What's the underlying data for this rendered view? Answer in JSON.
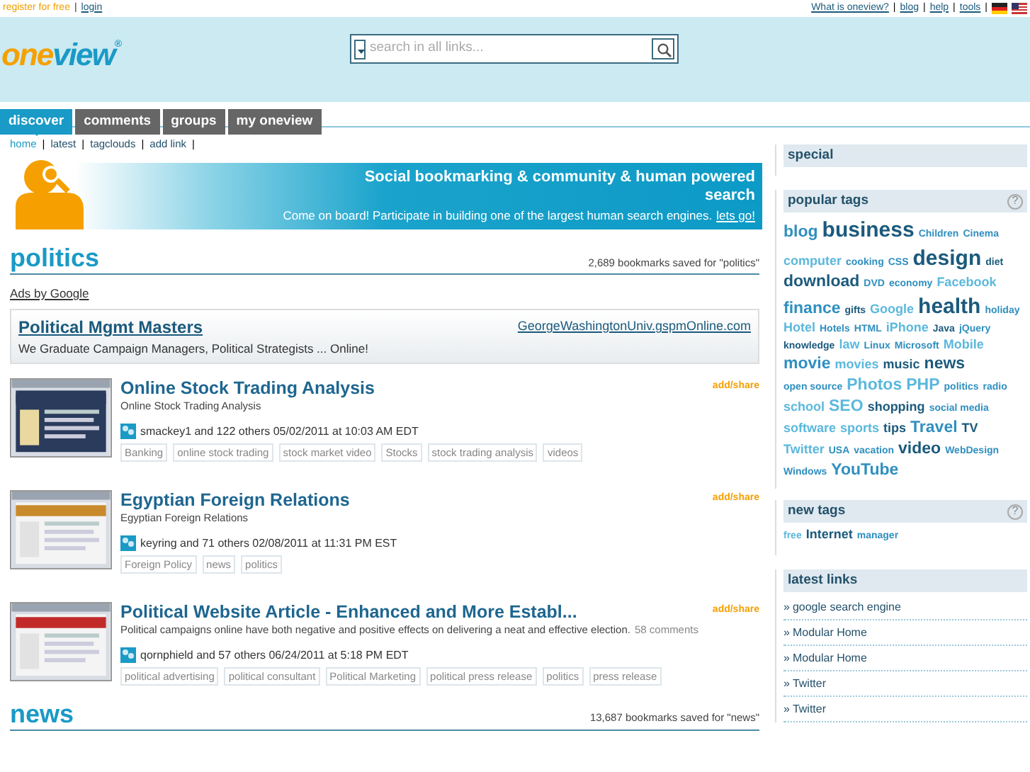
{
  "top_bar": {
    "separator": "|",
    "left_links": [
      "register for free",
      "login"
    ],
    "right_links": [
      "What is oneview?",
      "blog",
      "help",
      "tools"
    ]
  },
  "header": {
    "logo": {
      "part_1": "one",
      "part_2": "view",
      "mark": "®"
    },
    "search": {
      "placeholder": "search in all links..."
    }
  },
  "tabs": [
    {
      "label": "discover",
      "selected": true
    },
    {
      "label": "comments",
      "selected": false
    },
    {
      "label": "groups",
      "selected": false
    },
    {
      "label": "my oneview",
      "selected": false
    }
  ],
  "subnav": {
    "separator": "|",
    "links": [
      {
        "label": "home",
        "selected": true
      },
      {
        "label": "latest",
        "selected": false
      },
      {
        "label": "tagclouds",
        "selected": false
      },
      {
        "label": "add link",
        "selected": false
      }
    ]
  },
  "banner": {
    "headline": "Social bookmarking & community & human powered search",
    "text": "Come on board! Participate in building one of the largest human search engines.",
    "link": "lets go!"
  },
  "sections": [
    {
      "title": "politics",
      "count": "2,689 bookmarks saved for \"politics\"",
      "ads_label": "Ads by Google",
      "ad": {
        "title": "Political Mgmt Masters",
        "url": "GeorgeWashingtonUniv.gspmOnline.com",
        "text": "We Graduate Campaign Managers, Political Strategists ... Online!"
      },
      "items": [
        {
          "title": "Online Stock Trading Analysis",
          "action": "add/share",
          "description": "Online Stock Trading Analysis",
          "meta": "smackey1 and 122 others 05/02/2011 at 10:03 AM EDT",
          "tags": [
            "Banking",
            "online stock trading",
            "stock market video",
            "Stocks",
            "stock trading analysis",
            "videos"
          ]
        },
        {
          "title": "Egyptian Foreign Relations",
          "action": "add/share",
          "description": "Egyptian Foreign Relations",
          "meta": "keyring and 71 others 02/08/2011 at 11:31 PM EST",
          "tags": [
            "Foreign Policy",
            "news",
            "politics"
          ]
        },
        {
          "title": "Political Website Article - Enhanced and More Establ...",
          "action": "add/share",
          "description": "Political campaigns online have both negative and positive effects on delivering a neat and effective election.",
          "comments": "58 comments",
          "meta": "qornphield and 57 others 06/24/2011 at 5:18 PM EDT",
          "tags": [
            "political advertising",
            "political consultant",
            "Political Marketing",
            "political press release",
            "politics",
            "press release"
          ]
        }
      ]
    },
    {
      "title": "news",
      "count": "13,687 bookmarks saved for \"news\""
    }
  ],
  "sidebar": {
    "special": {
      "title": "special"
    },
    "popular_tags": {
      "title": "popular tags",
      "help": "?",
      "tags": [
        {
          "label": "blog",
          "kind": "large",
          "color": "#2f8fbf"
        },
        {
          "label": "business",
          "kind": "huge",
          "color": "#1b5a7c"
        },
        {
          "label": "Children",
          "kind": "small",
          "color": "#2f8fbf"
        },
        {
          "label": "Cinema",
          "kind": "small",
          "color": "#2f8fbf"
        },
        {
          "label": "computer",
          "kind": "medium",
          "color": "#5bb8dc"
        },
        {
          "label": "cooking",
          "kind": "small",
          "color": "#2f8fbf"
        },
        {
          "label": "CSS",
          "kind": "small",
          "color": "#2f8fbf"
        },
        {
          "label": "design",
          "kind": "huge",
          "color": "#1b5a7c"
        },
        {
          "label": "diet",
          "kind": "small",
          "color": "#1b5a7c"
        },
        {
          "label": "download",
          "kind": "large",
          "color": "#1b5a7c"
        },
        {
          "label": "DVD",
          "kind": "small",
          "color": "#2f8fbf"
        },
        {
          "label": "economy",
          "kind": "small",
          "color": "#2f8fbf"
        },
        {
          "label": "Facebook",
          "kind": "medium",
          "color": "#5bb8dc"
        },
        {
          "label": "finance",
          "kind": "large",
          "color": "#2f8fbf"
        },
        {
          "label": "gifts",
          "kind": "small",
          "color": "#1b5a7c"
        },
        {
          "label": "Google",
          "kind": "medium",
          "color": "#5bb8dc"
        },
        {
          "label": "health",
          "kind": "huge",
          "color": "#1b5a7c"
        },
        {
          "label": "holiday",
          "kind": "small",
          "color": "#2f8fbf"
        },
        {
          "label": "Hotel",
          "kind": "medium",
          "color": "#5bb8dc"
        },
        {
          "label": "Hotels",
          "kind": "small",
          "color": "#2f8fbf"
        },
        {
          "label": "HTML",
          "kind": "small",
          "color": "#2f8fbf"
        },
        {
          "label": "iPhone",
          "kind": "medium",
          "color": "#5bb8dc"
        },
        {
          "label": "Java",
          "kind": "small",
          "color": "#1b5a7c"
        },
        {
          "label": "jQuery",
          "kind": "small",
          "color": "#2f8fbf"
        },
        {
          "label": "knowledge",
          "kind": "small",
          "color": "#1b5a7c"
        },
        {
          "label": "law",
          "kind": "medium",
          "color": "#5bb8dc"
        },
        {
          "label": "Linux",
          "kind": "small",
          "color": "#2f8fbf"
        },
        {
          "label": "Microsoft",
          "kind": "small",
          "color": "#2f8fbf"
        },
        {
          "label": "Mobile",
          "kind": "medium",
          "color": "#5bb8dc"
        },
        {
          "label": "movie",
          "kind": "large",
          "color": "#2f8fbf"
        },
        {
          "label": "movies",
          "kind": "medium",
          "color": "#5bb8dc"
        },
        {
          "label": "music",
          "kind": "medium",
          "color": "#1b5a7c"
        },
        {
          "label": "news",
          "kind": "large",
          "color": "#1b5a7c"
        },
        {
          "label": "open source",
          "kind": "small",
          "color": "#2f8fbf"
        },
        {
          "label": "Photos",
          "kind": "large",
          "color": "#5bb8dc"
        },
        {
          "label": "PHP",
          "kind": "large",
          "color": "#5bb8dc"
        },
        {
          "label": "politics",
          "kind": "small",
          "color": "#2f8fbf"
        },
        {
          "label": "radio",
          "kind": "small",
          "color": "#2f8fbf"
        },
        {
          "label": "school",
          "kind": "medium",
          "color": "#5bb8dc"
        },
        {
          "label": "SEO",
          "kind": "large",
          "color": "#5bb8dc"
        },
        {
          "label": "shopping",
          "kind": "medium",
          "color": "#1b5a7c"
        },
        {
          "label": "social media",
          "kind": "small",
          "color": "#2f8fbf"
        },
        {
          "label": "software",
          "kind": "medium",
          "color": "#5bb8dc"
        },
        {
          "label": "sports",
          "kind": "medium",
          "color": "#5bb8dc"
        },
        {
          "label": "tips",
          "kind": "medium",
          "color": "#1b5a7c"
        },
        {
          "label": "Travel",
          "kind": "large",
          "color": "#2f8fbf"
        },
        {
          "label": "TV",
          "kind": "medium",
          "color": "#1b5a7c"
        },
        {
          "label": "Twitter",
          "kind": "medium",
          "color": "#5bb8dc"
        },
        {
          "label": "USA",
          "kind": "small",
          "color": "#2f8fbf"
        },
        {
          "label": "vacation",
          "kind": "small",
          "color": "#2f8fbf"
        },
        {
          "label": "video",
          "kind": "large",
          "color": "#1b5a7c"
        },
        {
          "label": "WebDesign",
          "kind": "small",
          "color": "#2f8fbf"
        },
        {
          "label": "Windows",
          "kind": "small",
          "color": "#2f8fbf"
        },
        {
          "label": "YouTube",
          "kind": "large",
          "color": "#2f8fbf"
        }
      ]
    },
    "new_tags": {
      "title": "new tags",
      "help": "?",
      "tags": [
        {
          "label": "free",
          "kind": "small",
          "color": "#5bb8dc"
        },
        {
          "label": "Internet",
          "kind": "medium",
          "color": "#1b5a7c"
        },
        {
          "label": "manager",
          "kind": "small",
          "color": "#2f8fbf"
        }
      ]
    },
    "latest_links": {
      "title": "latest links",
      "bullet": "»",
      "links": [
        "google search engine",
        "Modular Home",
        "Modular Home",
        "Twitter",
        "Twitter"
      ]
    }
  }
}
